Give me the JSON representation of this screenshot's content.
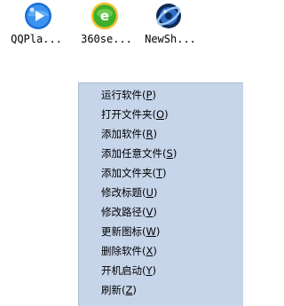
{
  "desktop": {
    "apps": [
      {
        "label": "QQPla...",
        "icon": "qqplayer-icon",
        "color": "#1a6fd6"
      },
      {
        "label": "360se...",
        "icon": "360se-browser-icon",
        "color": "#3fae2a"
      },
      {
        "label": "NewSh...",
        "icon": "newshortcut-icon",
        "color": "#1b4f9c"
      }
    ]
  },
  "context_menu": {
    "background": "#c7d5ea",
    "items": [
      {
        "text": "运行软件(",
        "accel": "P",
        "close": ")"
      },
      {
        "text": "打开文件夹(",
        "accel": "O",
        "close": ")"
      },
      {
        "text": "添加软件(",
        "accel": "R",
        "close": ")"
      },
      {
        "text": "添加任意文件(",
        "accel": "S",
        "close": ")"
      },
      {
        "text": "添加文件夹(",
        "accel": "T",
        "close": ")"
      },
      {
        "text": "修改标题(",
        "accel": "U",
        "close": ")"
      },
      {
        "text": "修改路径(",
        "accel": "V",
        "close": ")"
      },
      {
        "text": "更新图标(",
        "accel": "W",
        "close": ")"
      },
      {
        "text": "删除软件(",
        "accel": "X",
        "close": ")"
      },
      {
        "text": "开机启动(",
        "accel": "Y",
        "close": ")"
      },
      {
        "text": "刷新(",
        "accel": "Z",
        "close": ")"
      }
    ]
  }
}
